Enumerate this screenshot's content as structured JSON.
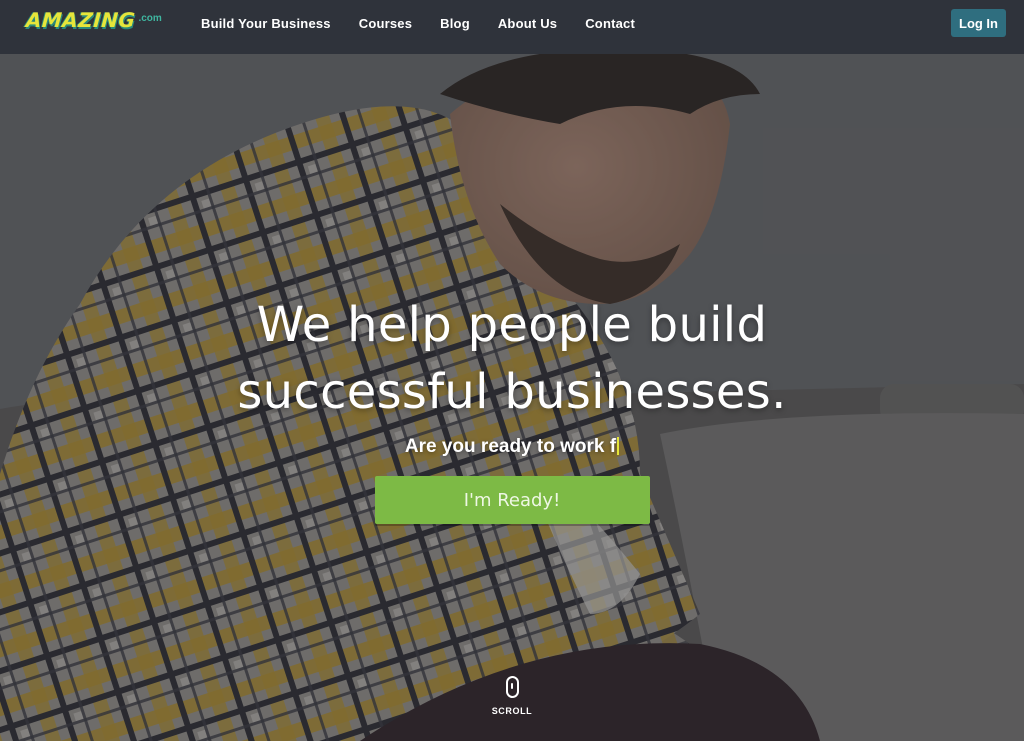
{
  "brand": {
    "logo_text": "AMAZING",
    "logo_suffix": ".com"
  },
  "nav": {
    "items": [
      {
        "label": "Build Your Business"
      },
      {
        "label": "Courses"
      },
      {
        "label": "Blog"
      },
      {
        "label": "About Us"
      },
      {
        "label": "Contact"
      }
    ],
    "login_label": "Log In"
  },
  "hero": {
    "headline_line1": "We help people build",
    "headline_line2": "successful businesses.",
    "tagline": "Are you ready to work f",
    "cta_label": "I'm Ready!",
    "scroll_label": "SCROLL",
    "scroll_icon": "mouse-scroll-icon"
  },
  "colors": {
    "nav_bg": "#2f333b",
    "logo_yellow": "#e6e53a",
    "logo_teal": "#3fb6a0",
    "login_bg": "#2f6e7f",
    "cta_green": "#7dba45"
  }
}
